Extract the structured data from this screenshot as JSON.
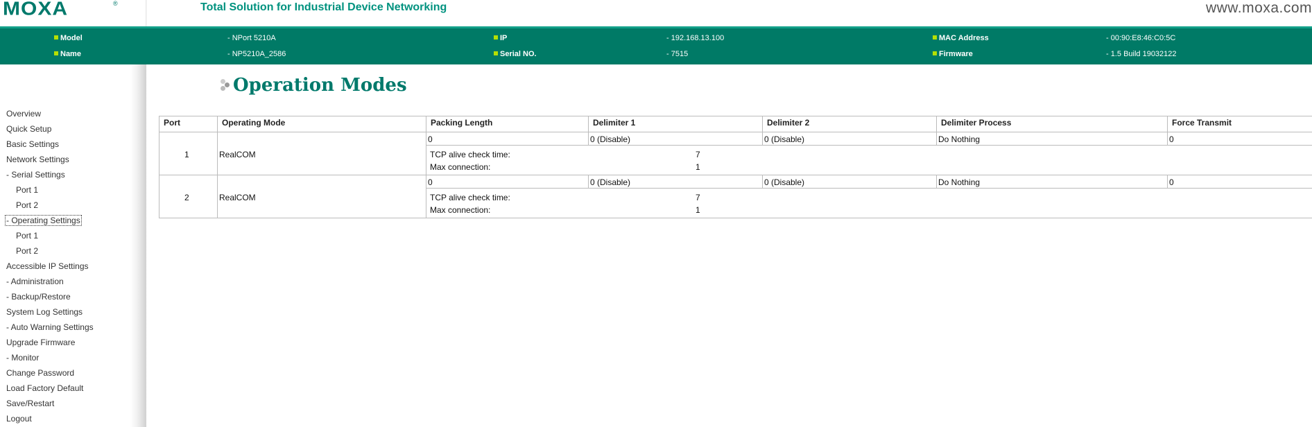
{
  "header": {
    "logo": "MOXA",
    "logo_mark": "®",
    "tagline": "Total Solution for Industrial Device Networking",
    "site_url": "www.moxa.com"
  },
  "info": {
    "model_key": "Model",
    "model_val": "- NPort 5210A",
    "name_key": "Name",
    "name_val": "- NP5210A_2586",
    "ip_key": "IP",
    "ip_val": "- 192.168.13.100",
    "serial_key": "Serial NO.",
    "serial_val": "- 7515",
    "mac_key": "MAC Address",
    "mac_val": "- 00:90:E8:46:C0:5C",
    "firmware_key": "Firmware",
    "firmware_val": "- 1.5 Build 19032122"
  },
  "sidebar": {
    "items": [
      "Overview",
      "Quick Setup",
      "Basic Settings",
      "Network Settings",
      "- Serial Settings",
      "Port 1",
      "Port 2",
      "- Operating Settings",
      "Port 1",
      "Port 2",
      "Accessible IP Settings",
      "- Administration",
      "- Backup/Restore",
      "System Log Settings",
      "- Auto Warning Settings",
      "Upgrade Firmware",
      "- Monitor",
      "Change Password",
      "Load Factory Default",
      "Save/Restart",
      "Logout"
    ]
  },
  "page": {
    "title": "Operation Modes"
  },
  "table": {
    "headers": [
      "Port",
      "Operating Mode",
      "Packing Length",
      "Delimiter 1",
      "Delimiter 2",
      "Delimiter Process",
      "Force Transmit"
    ],
    "rows": [
      {
        "port": "1",
        "mode": "RealCOM",
        "packing_length": "0",
        "delimiter1": "0 (Disable)",
        "delimiter2": "0 (Disable)",
        "delimiter_process": "Do Nothing",
        "force_transmit": "0",
        "tcp_alive_label": "TCP alive check time:",
        "tcp_alive_value": "7",
        "max_conn_label": "Max connection:",
        "max_conn_value": "1"
      },
      {
        "port": "2",
        "mode": "RealCOM",
        "packing_length": "0",
        "delimiter1": "0 (Disable)",
        "delimiter2": "0 (Disable)",
        "delimiter_process": "Do Nothing",
        "force_transmit": "0",
        "tcp_alive_label": "TCP alive check time:",
        "tcp_alive_value": "7",
        "max_conn_label": "Max connection:",
        "max_conn_value": "1"
      }
    ]
  },
  "colors": {
    "brand": "#00796b",
    "info_bar": "#007a66",
    "bullet": "#b4e000"
  }
}
